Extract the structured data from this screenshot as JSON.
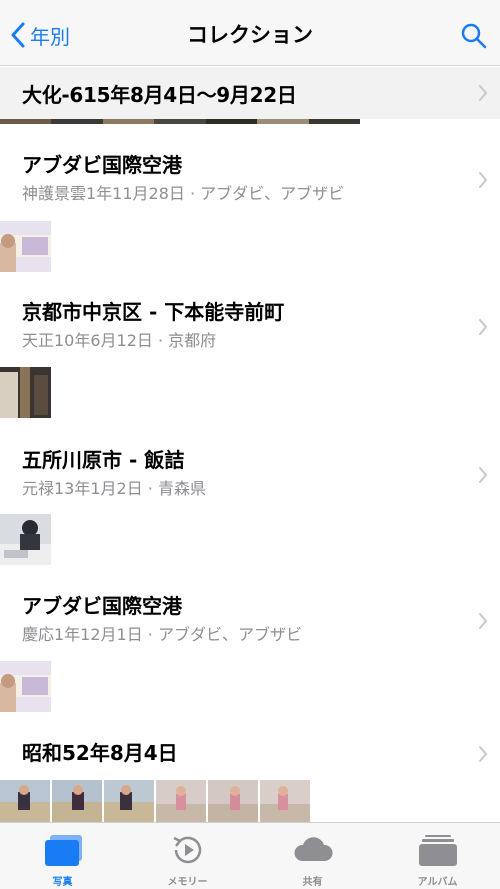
{
  "nav": {
    "back_label": "年別",
    "title": "コレクション"
  },
  "section_header": {
    "label": "大化-615年8月4日〜9月22日"
  },
  "moments": [
    {
      "title": "アブダビ国際空港",
      "subtitle": "神護景雲1年11月28日 · アブダビ、アブザビ"
    },
    {
      "title": "京都市中京区 - 下本能寺前町",
      "subtitle": "天正10年6月12日 · 京都府"
    },
    {
      "title": "五所川原市 - 飯詰",
      "subtitle": "元禄13年1月2日 · 青森県"
    },
    {
      "title": "アブダビ国際空港",
      "subtitle": "慶応1年12月1日 · アブダビ、アブザビ"
    },
    {
      "title": "昭和52年8月4日",
      "subtitle": ""
    }
  ],
  "tabs": [
    {
      "label": "写真",
      "icon": "photos-icon",
      "active": true
    },
    {
      "label": "メモリー",
      "icon": "memories-icon",
      "active": false
    },
    {
      "label": "共有",
      "icon": "cloud-icon",
      "active": false
    },
    {
      "label": "アルバム",
      "icon": "albums-icon",
      "active": false
    }
  ],
  "colors": {
    "accent": "#1a7cf5",
    "secondary_text": "#8e8e93"
  }
}
